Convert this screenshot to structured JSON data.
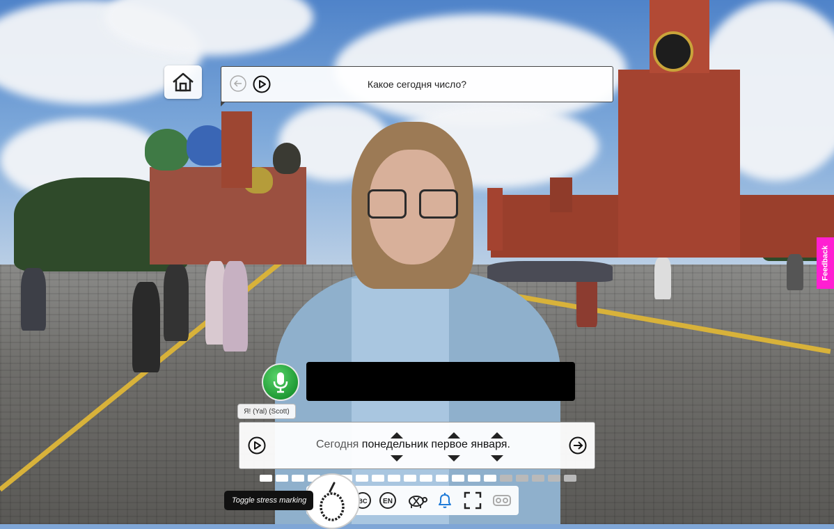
{
  "question": {
    "text": "Какое сегодня число?"
  },
  "voice": {
    "label": "Я! (Yal) (Scott)"
  },
  "sentence": {
    "prefix": "Сегодня",
    "words": [
      "понедельник",
      "первое",
      "января."
    ]
  },
  "progress": {
    "total_segments": 20,
    "completed_segments": 15,
    "color_done": "#ffffff",
    "color_pending": "#b9b9b9"
  },
  "toolbar": {
    "tooltip": "Toggle stress marking",
    "icons": [
      "stress-marking-icon",
      "abc-icon",
      "english-icon",
      "turtle-icon",
      "bell-icon",
      "fullscreen-icon",
      "vr-headset-icon"
    ]
  },
  "feedback": {
    "label": "Feedback"
  },
  "colors": {
    "mic_green": "#1f9a34",
    "feedback_pink": "#ff1fd2",
    "bell_blue": "#1f7bd8"
  }
}
